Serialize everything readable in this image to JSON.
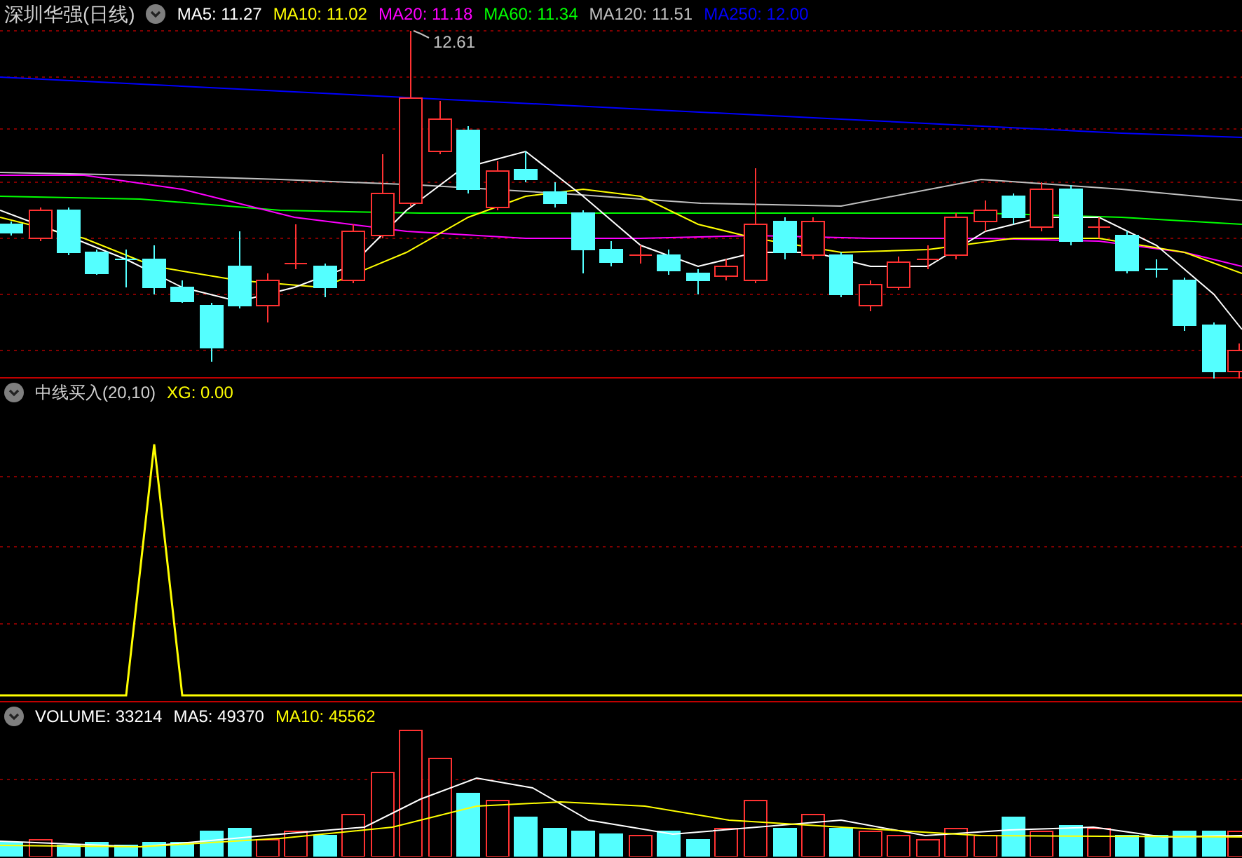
{
  "panels": [
    {
      "kind": "price",
      "title": "深圳华强(日线)",
      "legends": [
        {
          "text": "MA5: 11.27",
          "color": "#ffffff"
        },
        {
          "text": "MA10: 11.02",
          "color": "#ffff00"
        },
        {
          "text": "MA20: 11.18",
          "color": "#ff00ff"
        },
        {
          "text": "MA60: 11.34",
          "color": "#00ff00"
        },
        {
          "text": "MA120: 11.51",
          "color": "#c0c0c0"
        },
        {
          "text": "MA250: 12.00",
          "color": "#0000ff"
        }
      ],
      "high_label": "12.61"
    },
    {
      "kind": "indicator",
      "title": "中线买入(20,10)",
      "legends": [
        {
          "text": "XG: 0.00",
          "color": "#ffff00"
        }
      ]
    },
    {
      "kind": "volume",
      "legends": [
        {
          "text": "VOLUME: 33214",
          "color": "#ffffff"
        },
        {
          "text": "MA5: 49370",
          "color": "#ffffff"
        },
        {
          "text": "MA10: 45562",
          "color": "#ffff00"
        }
      ]
    }
  ]
}
